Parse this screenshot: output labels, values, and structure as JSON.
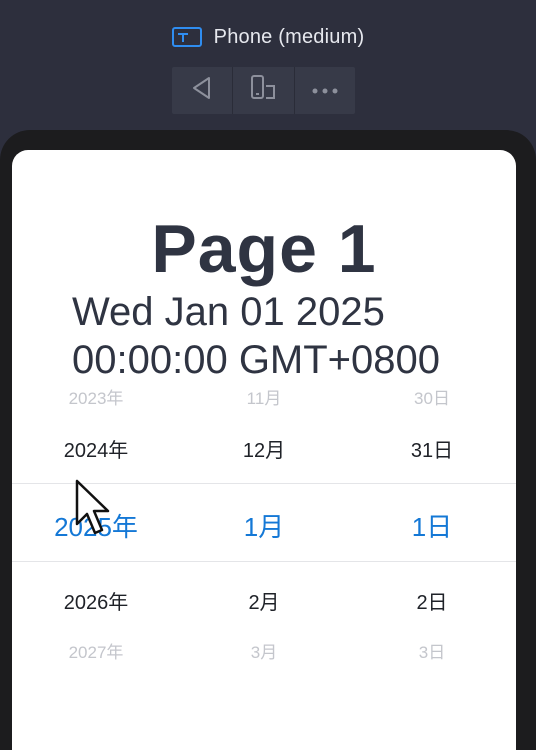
{
  "device": {
    "title": "Phone (medium)",
    "icon": "device-icon"
  },
  "toolbar": {
    "buttons": [
      {
        "name": "back-icon"
      },
      {
        "name": "rotate-device-icon"
      },
      {
        "name": "more-icon"
      }
    ]
  },
  "page": {
    "title": "Page 1",
    "date_line1": "Wed Jan 01 2025",
    "date_line2": "00:00:00 GMT+0800"
  },
  "picker": {
    "years": [
      "2023年",
      "2024年",
      "2025年",
      "2026年",
      "2027年"
    ],
    "months": [
      "11月",
      "12月",
      "1月",
      "2月",
      "3月"
    ],
    "days": [
      "30日",
      "31日",
      "1日",
      "2日",
      "3日"
    ],
    "selected_index": 2
  },
  "colors": {
    "accent": "#1478d6",
    "frame": "#1c1c1e",
    "background": "#2d2f3d",
    "text": "#2f3442"
  }
}
